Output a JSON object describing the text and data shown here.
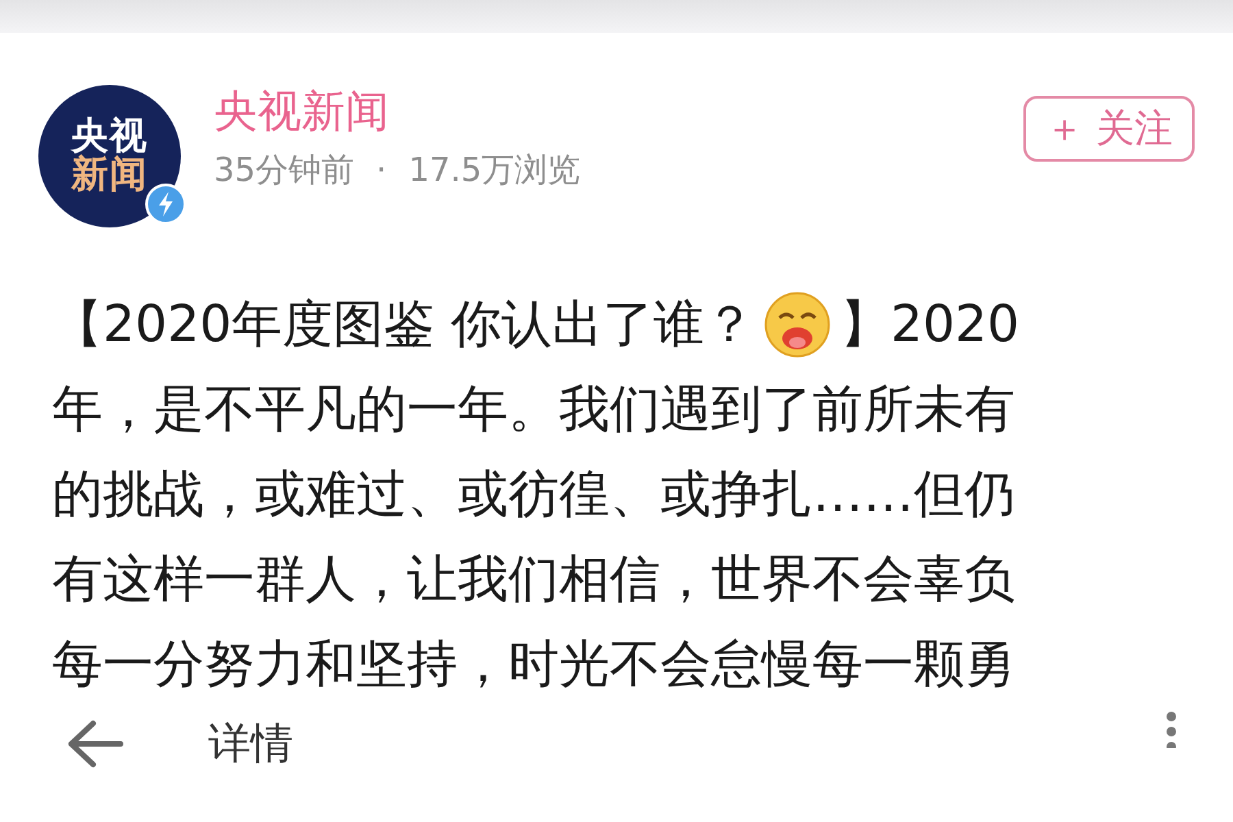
{
  "account": {
    "avatar_text": [
      "央视",
      "新闻"
    ],
    "verified": true,
    "name": "央视新闻",
    "time": "35分钟前",
    "separator": "·",
    "views": "17.5万浏览"
  },
  "follow_button": {
    "label": "＋ 关注"
  },
  "post_lines": [
    [
      {
        "kind": "text",
        "text": "【2020年度图鉴 你认出了谁？"
      },
      {
        "kind": "emoji"
      },
      {
        "kind": "text",
        "text": "】2020"
      }
    ],
    [
      {
        "kind": "text",
        "text": "年，是不平凡的一年。我们遇到了前所未有"
      }
    ],
    [
      {
        "kind": "text",
        "text": "的挑战，或难过、或彷徨、或挣扎……但仍"
      }
    ],
    [
      {
        "kind": "text",
        "text": "有这样一群人，让我们相信，世界不会辜负"
      }
    ],
    [
      {
        "kind": "text",
        "text": "每一分努力和坚持，时光不会怠慢每一颗勇"
      }
    ]
  ],
  "bottom_bar": {
    "title": "详情"
  }
}
